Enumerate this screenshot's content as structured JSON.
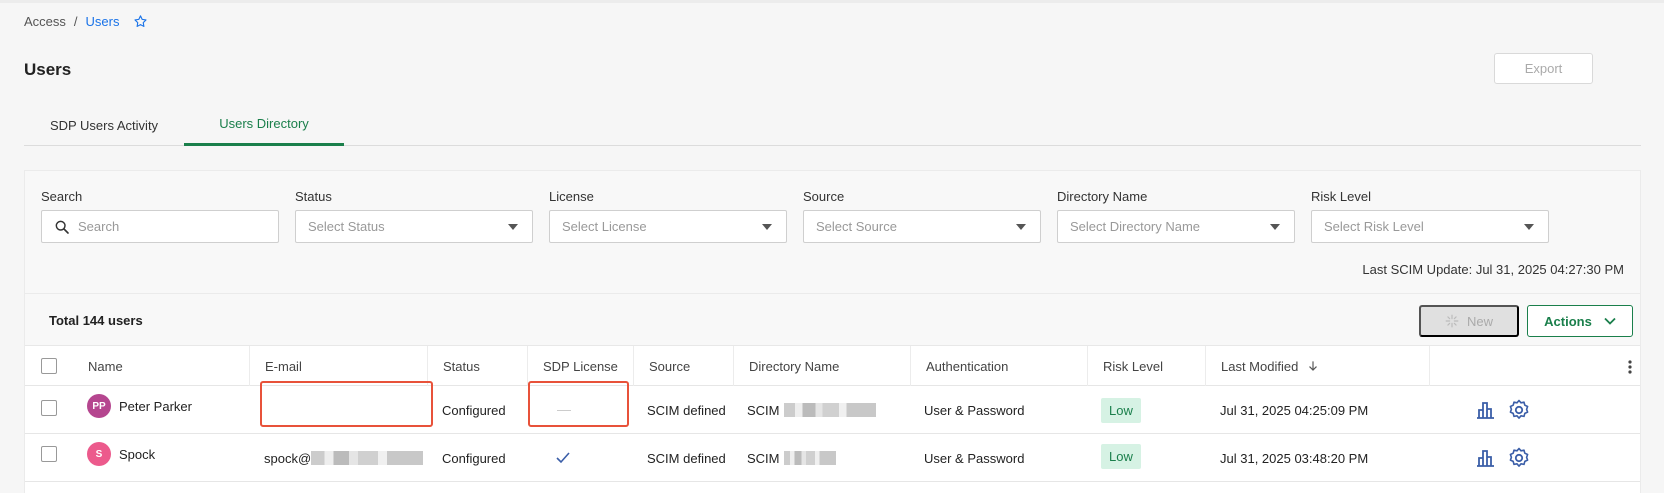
{
  "breadcrumb": {
    "root": "Access",
    "separator": "/",
    "current": "Users"
  },
  "page": {
    "title": "Users",
    "export_label": "Export"
  },
  "tabs": [
    {
      "label": "SDP Users Activity",
      "active": false
    },
    {
      "label": "Users Directory",
      "active": true
    }
  ],
  "filters": {
    "search": {
      "label": "Search",
      "placeholder": "Search"
    },
    "status": {
      "label": "Status",
      "placeholder": "Select Status"
    },
    "license": {
      "label": "License",
      "placeholder": "Select License"
    },
    "source": {
      "label": "Source",
      "placeholder": "Select Source"
    },
    "directory": {
      "label": "Directory Name",
      "placeholder": "Select Directory Name"
    },
    "risk": {
      "label": "Risk Level",
      "placeholder": "Select Risk Level"
    },
    "last_scim_update": "Last SCIM Update: Jul 31, 2025 04:27:30 PM"
  },
  "table": {
    "total": "Total 144 users",
    "new_label": "New",
    "actions_label": "Actions",
    "columns": [
      "Name",
      "E-mail",
      "Status",
      "SDP License",
      "Source",
      "Directory Name",
      "Authentication",
      "Risk Level",
      "Last Modified"
    ],
    "rows": [
      {
        "initials": "PP",
        "avatar_color": "#b5468f",
        "name": "Peter Parker",
        "email": "",
        "status": "Configured",
        "license": "—",
        "source": "SCIM defined",
        "directory": "SCIM",
        "auth": "User & Password",
        "risk": "Low",
        "modified": "Jul 31, 2025 04:25:09 PM"
      },
      {
        "initials": "S",
        "avatar_color": "#ec5a8c",
        "name": "Spock",
        "email": "spock@",
        "status": "Configured",
        "license": "✓",
        "source": "SCIM defined",
        "directory": "SCIM",
        "auth": "User & Password",
        "risk": "Low",
        "modified": "Jul 31, 2025 03:48:20 PM"
      }
    ]
  },
  "colors": {
    "accent": "#1a7f4b",
    "link": "#1a73e8",
    "highlight": "#e8523a",
    "risk_low_bg": "#d6f2e4",
    "icon": "#3b5ea8"
  }
}
